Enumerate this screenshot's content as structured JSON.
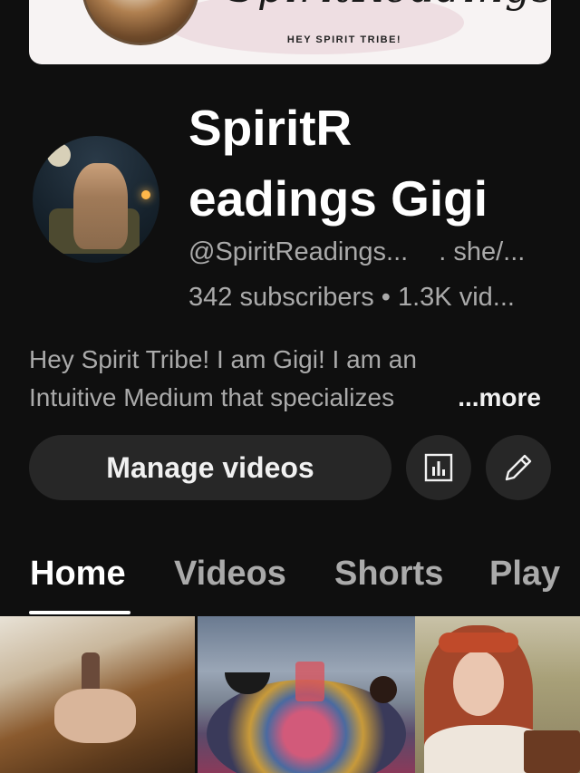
{
  "banner": {
    "script_text": "SpiritReadings Gigi",
    "tagline": "HEY SPIRIT TRIBE!"
  },
  "channel": {
    "name_line1": "SpiritR",
    "name_line2": "eadings Gigi",
    "handle": "@SpiritReadings...",
    "pronouns": ". she/...",
    "stats": "342 subscribers • 1.3K vid..."
  },
  "description": {
    "line1": "Hey Spirit Tribe! I am Gigi! I am an",
    "line2": "Intuitive Medium that specializes",
    "more_label": "...more"
  },
  "actions": {
    "manage_label": "Manage videos",
    "analytics_icon": "bar-chart-icon",
    "edit_icon": "pencil-icon"
  },
  "tabs": [
    {
      "label": "Home",
      "active": true
    },
    {
      "label": "Videos",
      "active": false
    },
    {
      "label": "Shorts",
      "active": false
    },
    {
      "label": "Play",
      "active": false
    }
  ],
  "colors": {
    "background": "#0f0f0f",
    "button_bg": "#272727",
    "text_primary": "#f1f1f1",
    "text_secondary": "#aaaaaa"
  }
}
